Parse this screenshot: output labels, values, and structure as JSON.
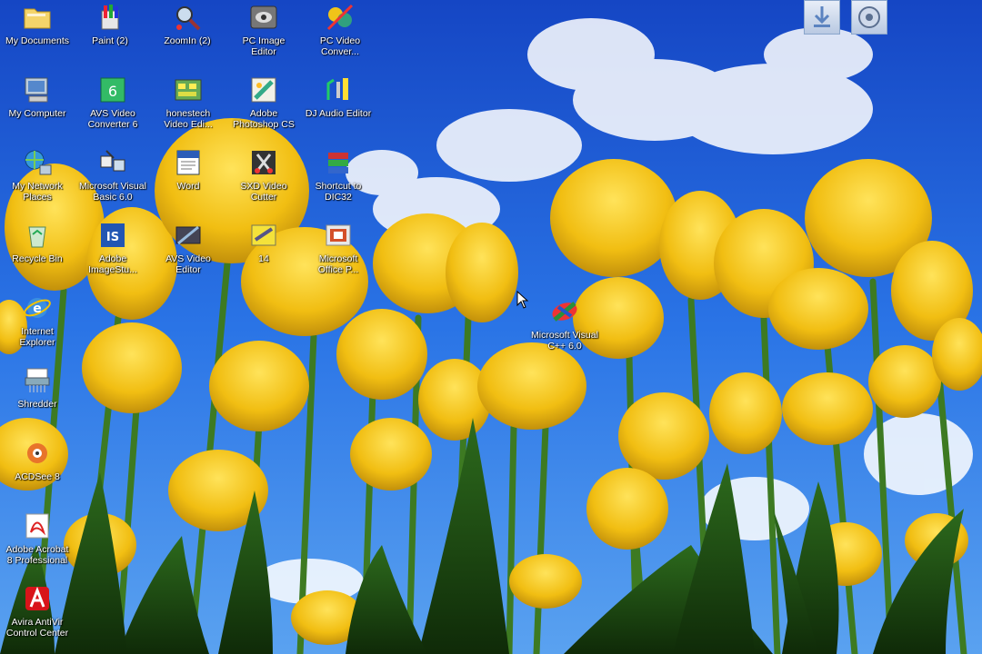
{
  "desktop": {
    "icons": [
      {
        "label": "My Documents",
        "icon": "folder-icon"
      },
      {
        "label": "Paint (2)",
        "icon": "paint-icon"
      },
      {
        "label": "ZoomIn (2)",
        "icon": "zoomin-icon"
      },
      {
        "label": "PC Image\nEditor",
        "icon": "image-editor-icon"
      },
      {
        "label": "PC Video\nConver...",
        "icon": "video-converter-icon"
      },
      {
        "label": "My Computer",
        "icon": "computer-icon"
      },
      {
        "label": "AVS Video\nConverter 6",
        "icon": "avs-converter-icon"
      },
      {
        "label": "honestech\nVideo Edi...",
        "icon": "video-edit-icon"
      },
      {
        "label": "Adobe\nPhotoshop CS",
        "icon": "photoshop-icon"
      },
      {
        "label": "DJ Audio Editor",
        "icon": "audio-editor-icon"
      },
      {
        "label": "My Network\nPlaces",
        "icon": "network-icon"
      },
      {
        "label": "Microsoft Visual\nBasic 6.0",
        "icon": "visual-basic-icon"
      },
      {
        "label": "Word",
        "icon": "word-icon"
      },
      {
        "label": "SXD Video\nCutter",
        "icon": "video-cutter-icon"
      },
      {
        "label": "Shortcut to\nDIC32",
        "icon": "shortcut-icon"
      },
      {
        "label": "Recycle Bin",
        "icon": "recycle-bin-icon"
      },
      {
        "label": "Adobe\nImageStu...",
        "icon": "imagestudio-icon"
      },
      {
        "label": "AVS Video\nEditor",
        "icon": "avs-editor-icon"
      },
      {
        "label": "14",
        "icon": "scanner-icon"
      },
      {
        "label": "Microsoft\nOffice P...",
        "icon": "office-picture-icon"
      },
      {
        "label": "Internet\nExplorer",
        "icon": "internet-explorer-icon"
      },
      {
        "label": "Microsoft Visual\nC++ 6.0",
        "icon": "visual-cpp-icon"
      },
      {
        "label": "Shredder",
        "icon": "shredder-icon"
      },
      {
        "label": "ACDSee 8",
        "icon": "acdsee-icon"
      },
      {
        "label": "Adobe Acrobat\n8 Professional",
        "icon": "acrobat-icon"
      },
      {
        "label": "Avira AntiVir\nControl Center",
        "icon": "avira-icon"
      }
    ]
  },
  "tray": [
    {
      "icon": "download-icon"
    },
    {
      "icon": "disc-icon"
    }
  ],
  "colors": {
    "sky": "#1f5fd8",
    "tulip": "#f2c21a",
    "stem": "#3f7a23"
  }
}
